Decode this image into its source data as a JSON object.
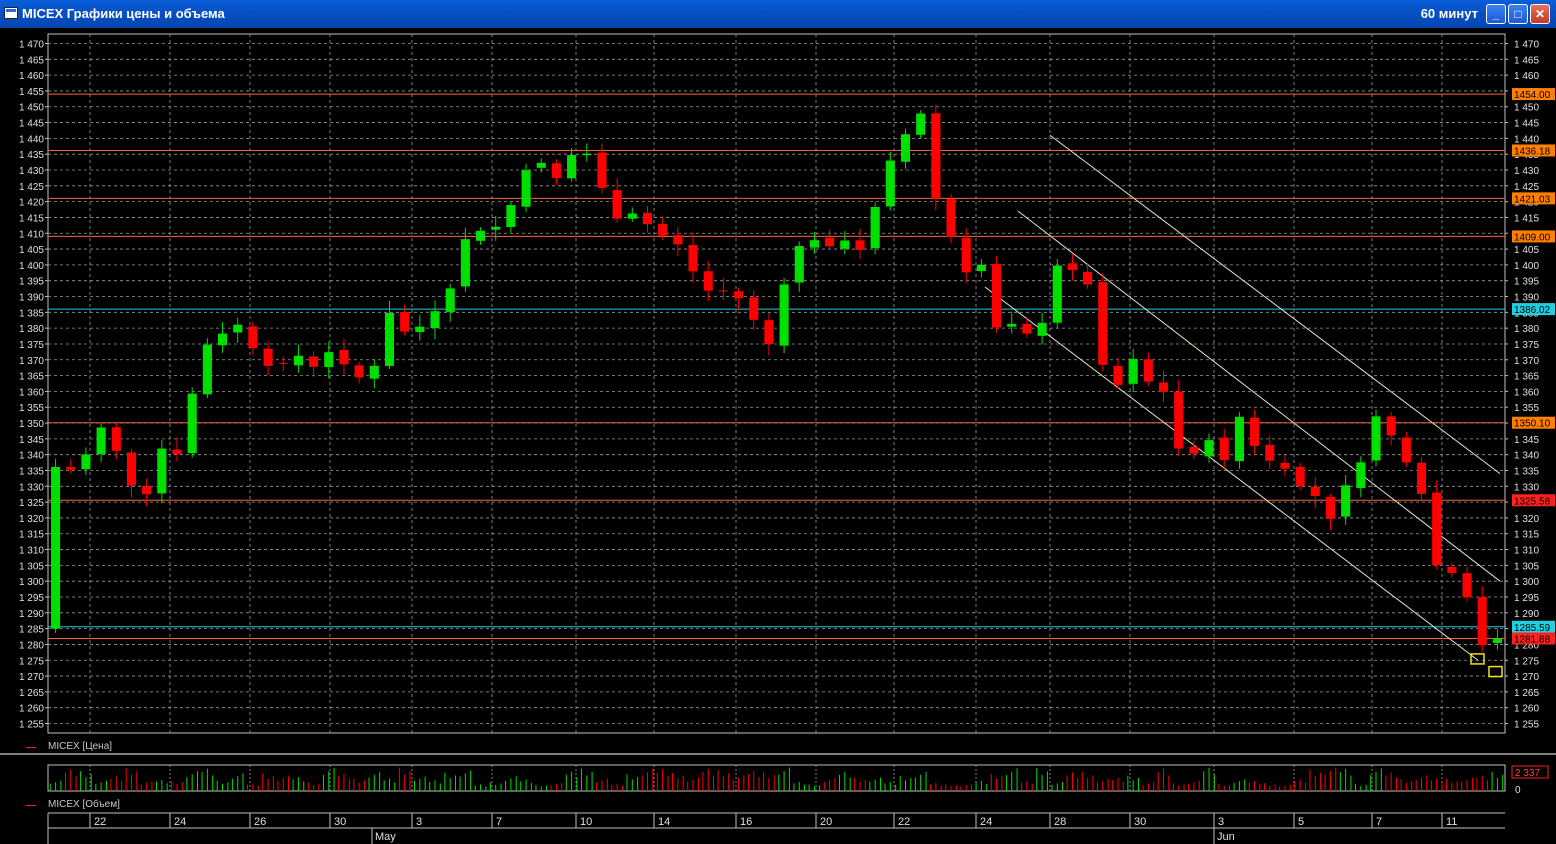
{
  "window": {
    "title": "MICEX Графики цены и объема",
    "interval": "60 минут"
  },
  "legend": {
    "price": "MICEX [Цена]",
    "volume": "MICEX [Объем]"
  },
  "colors": {
    "up": "#00e000",
    "down": "#ff0000",
    "grid": "#9a9a9a",
    "level": "#ff6040",
    "channel": "#e8e8c0"
  },
  "chart_data": {
    "type": "candlestick",
    "ylim": [
      1252,
      1473
    ],
    "yticks": [
      1255,
      1260,
      1265,
      1270,
      1275,
      1280,
      1285,
      1290,
      1295,
      1300,
      1305,
      1310,
      1315,
      1320,
      1325,
      1330,
      1335,
      1340,
      1345,
      1350,
      1355,
      1360,
      1365,
      1370,
      1375,
      1380,
      1385,
      1390,
      1395,
      1400,
      1405,
      1410,
      1415,
      1420,
      1425,
      1430,
      1435,
      1440,
      1445,
      1450,
      1455,
      1460,
      1465,
      1470
    ],
    "ytick_labels": [
      "1 255",
      "1 260",
      "1 265",
      "1 270",
      "1 275",
      "1 280",
      "1 285",
      "1 290",
      "1 295",
      "1 300",
      "1 305",
      "1 310",
      "1 315",
      "1 320",
      "1 325",
      "1 330",
      "1 335",
      "1 340",
      "1 345",
      "1 350",
      "1 355",
      "1 360",
      "1 365",
      "1 370",
      "1 375",
      "1 380",
      "1 385",
      "1 390",
      "1 395",
      "1 400",
      "1 405",
      "1 410",
      "1 415",
      "1 420",
      "1 425",
      "1 430",
      "1 435",
      "1 440",
      "1 445",
      "1 450",
      "1 455",
      "1 460",
      "1 465",
      "1 470"
    ],
    "x_day_labels": [
      "22",
      "24",
      "26",
      "30",
      "3",
      "7",
      "10",
      "14",
      "16",
      "20",
      "22",
      "24",
      "28",
      "30",
      "3",
      "5",
      "7",
      "11"
    ],
    "x_month_labels": [
      "May",
      "Jun"
    ],
    "levels": [
      {
        "value": 1454.0,
        "label": "1454.00",
        "color": "#ff7f00"
      },
      {
        "value": 1436.18,
        "label": "1436.18",
        "color": "#ff7f00"
      },
      {
        "value": 1421.03,
        "label": "1421.03",
        "color": "#ff7f00"
      },
      {
        "value": 1409.0,
        "label": "1409.00",
        "color": "#ff7f00"
      },
      {
        "value": 1386.02,
        "label": "1386.02",
        "color": "#20d0e0"
      },
      {
        "value": 1350.1,
        "label": "1350.10",
        "color": "#ff7f00"
      },
      {
        "value": 1325.58,
        "label": "1325.58",
        "color": "#ff2020"
      },
      {
        "value": 1285.59,
        "label": "1285.59",
        "color": "#20d0e0"
      },
      {
        "value": 1281.88,
        "label": "1281.88",
        "color": "#ff2020"
      }
    ],
    "anchors": [
      [
        0,
        1343
      ],
      [
        0.8,
        1332
      ],
      [
        2.5,
        1340
      ],
      [
        3.8,
        1351
      ],
      [
        5,
        1334
      ],
      [
        6.3,
        1325
      ],
      [
        7.5,
        1342
      ],
      [
        8.8,
        1340
      ],
      [
        10,
        1373
      ],
      [
        11.3,
        1378
      ],
      [
        12.5,
        1381
      ],
      [
        13.8,
        1372
      ],
      [
        15,
        1366
      ],
      [
        16.3,
        1372
      ],
      [
        17.5,
        1368
      ],
      [
        18.8,
        1374
      ],
      [
        20,
        1364
      ],
      [
        21.3,
        1365
      ],
      [
        22.5,
        1385
      ],
      [
        23.8,
        1377
      ],
      [
        25,
        1383
      ],
      [
        26.3,
        1390
      ],
      [
        27.5,
        1408
      ],
      [
        28.8,
        1412
      ],
      [
        30,
        1412
      ],
      [
        31.3,
        1430
      ],
      [
        32.5,
        1432
      ],
      [
        33.8,
        1426
      ],
      [
        35,
        1441
      ],
      [
        36.3,
        1426
      ],
      [
        37.5,
        1415
      ],
      [
        38.8,
        1417
      ],
      [
        40,
        1410
      ],
      [
        41.3,
        1408
      ],
      [
        42.5,
        1398
      ],
      [
        43.8,
        1390
      ],
      [
        45,
        1393
      ],
      [
        46.3,
        1384
      ],
      [
        47.5,
        1375
      ],
      [
        48.8,
        1400
      ],
      [
        50,
        1410
      ],
      [
        51.3,
        1405
      ],
      [
        52.5,
        1408
      ],
      [
        53.8,
        1404
      ],
      [
        55,
        1428
      ],
      [
        56.3,
        1440
      ],
      [
        57.5,
        1448
      ],
      [
        58,
        1446
      ],
      [
        58.6,
        1416
      ],
      [
        59.5,
        1409
      ],
      [
        60.5,
        1398
      ],
      [
        61.5,
        1400
      ],
      [
        62.5,
        1380
      ],
      [
        63.5,
        1381
      ],
      [
        64.5,
        1378
      ],
      [
        65.5,
        1382
      ],
      [
        66.5,
        1400
      ],
      [
        67.5,
        1398
      ],
      [
        68.5,
        1394
      ],
      [
        69.5,
        1368
      ],
      [
        70.5,
        1362
      ],
      [
        71.5,
        1370
      ],
      [
        72.5,
        1363
      ],
      [
        73.5,
        1360
      ],
      [
        74,
        1343
      ],
      [
        75.5,
        1340
      ],
      [
        76.5,
        1345
      ],
      [
        77.5,
        1338
      ],
      [
        78.5,
        1352
      ],
      [
        79.5,
        1343
      ],
      [
        80.5,
        1338
      ],
      [
        81.5,
        1336
      ],
      [
        82.5,
        1330
      ],
      [
        83.5,
        1327
      ],
      [
        84.5,
        1320
      ],
      [
        85.5,
        1330
      ],
      [
        86.5,
        1338
      ],
      [
        87.5,
        1352
      ],
      [
        88.5,
        1346
      ],
      [
        89.5,
        1338
      ],
      [
        90.5,
        1328
      ],
      [
        91,
        1308
      ],
      [
        92,
        1302
      ],
      [
        93,
        1304
      ],
      [
        93.8,
        1290
      ],
      [
        94.5,
        1280
      ],
      [
        95,
        1276
      ],
      [
        95.8,
        1285
      ]
    ],
    "volume_range": [
      0,
      2337
    ],
    "volume_label": "2 337",
    "volume_zero_label": "0"
  }
}
